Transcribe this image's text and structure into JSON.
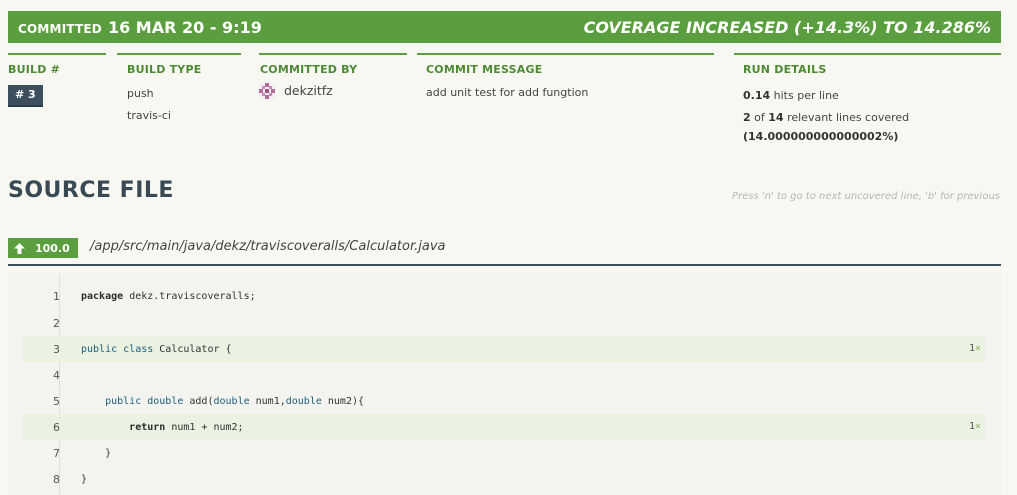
{
  "banner": {
    "committed_label": "COMMITTED",
    "committed_date": "16 MAR 20 - 9:19",
    "coverage_text": "COVERAGE INCREASED (+14.3%) TO 14.286%"
  },
  "build": {
    "header": "BUILD #",
    "number": "# 3"
  },
  "build_type": {
    "header": "BUILD TYPE",
    "values": [
      "push",
      "travis-ci"
    ]
  },
  "committed_by": {
    "header": "COMMITTED BY",
    "user": "dekzitfz"
  },
  "commit_message": {
    "header": "COMMIT MESSAGE",
    "text": "add unit test for add fungtion"
  },
  "run_details": {
    "header": "RUN DETAILS",
    "hits_value": "0.14",
    "hits_text": "hits per line",
    "covered_count": "2",
    "of_text": "of",
    "relevant_count": "14",
    "relevant_text": "relevant lines covered",
    "percent_text": "(14.000000000000002%)"
  },
  "source": {
    "title": "SOURCE FILE",
    "hint": "Press 'n' to go to next uncovered line, 'b' for previous",
    "coverage_badge": "100.0",
    "file_path": "/app/src/main/java/dekz/traviscoveralls/Calculator.java"
  },
  "code_lines": [
    {
      "number": "1",
      "code": "package dekz.traviscoveralls;",
      "hits": ""
    },
    {
      "number": "2",
      "code": "",
      "hits": ""
    },
    {
      "number": "3",
      "code": "public class Calculator {",
      "hits": "1"
    },
    {
      "number": "4",
      "code": "",
      "hits": ""
    },
    {
      "number": "5",
      "code": "    public double add(double num1,double num2){",
      "hits": ""
    },
    {
      "number": "6",
      "code": "        return num1 + num2;",
      "hits": "1"
    },
    {
      "number": "7",
      "code": "    }",
      "hits": ""
    },
    {
      "number": "8",
      "code": "}",
      "hits": ""
    }
  ],
  "hit_mark": "×",
  "colors": {
    "accent_green": "#5a9e3f",
    "dark_slate": "#3d4f5d",
    "covered_line": "#eaf2e1"
  },
  "icons": {
    "coverage_arrow": "arrow-up-icon",
    "avatar": "identicon-avatar"
  }
}
